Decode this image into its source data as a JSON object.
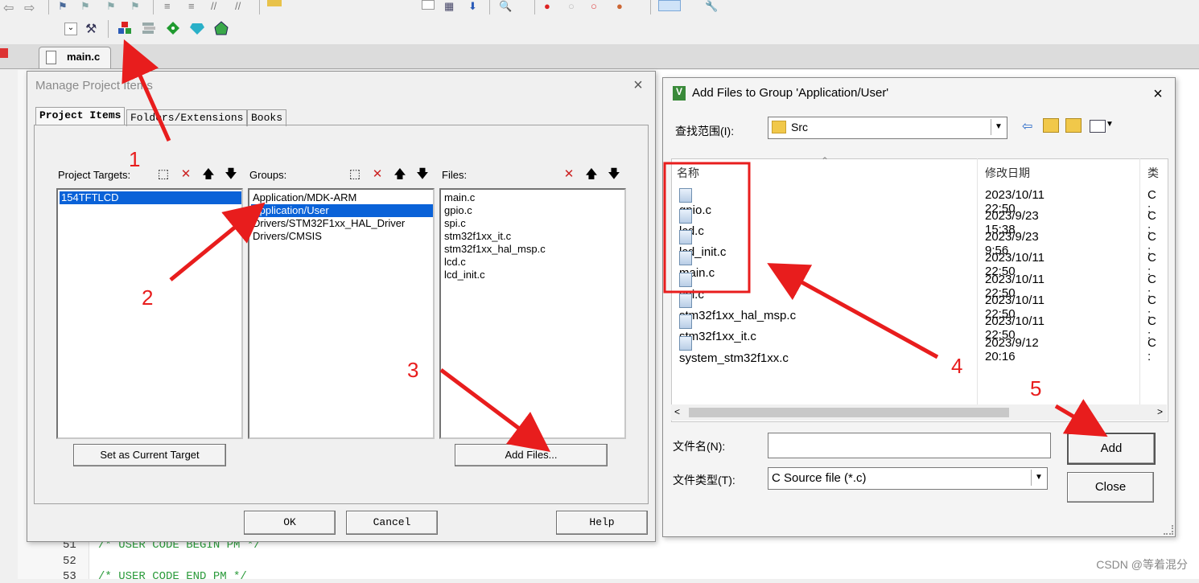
{
  "editor": {
    "tab_label": "main.c",
    "lines": [
      {
        "num": "51",
        "code": "/* USER CODE BEGIN PM */"
      },
      {
        "num": "52",
        "code": ""
      },
      {
        "num": "53",
        "code": "/* USER CODE END PM */"
      }
    ]
  },
  "manage_dialog": {
    "title": "Manage Project Items",
    "tabs": [
      "Project Items",
      "Folders/Extensions",
      "Books"
    ],
    "targets_label": "Project Targets:",
    "groups_label": "Groups:",
    "files_label": "Files:",
    "targets": [
      "154TFTLCD"
    ],
    "groups": [
      "Application/MDK-ARM",
      "Application/User",
      "Drivers/STM32F1xx_HAL_Driver",
      "Drivers/CMSIS"
    ],
    "selected_group": "Application/User",
    "files": [
      "main.c",
      "gpio.c",
      "spi.c",
      "stm32f1xx_it.c",
      "stm32f1xx_hal_msp.c",
      "lcd.c",
      "lcd_init.c"
    ],
    "set_target_label": "Set as Current Target",
    "add_files_label": "Add Files...",
    "ok_label": "OK",
    "cancel_label": "Cancel",
    "help_label": "Help"
  },
  "add_dialog": {
    "title": "Add Files to Group 'Application/User'",
    "lookin_label": "查找范围(I):",
    "lookin_value": "Src",
    "col_name": "名称",
    "col_date": "修改日期",
    "col_type": "类",
    "files": [
      {
        "name": "gpio.c",
        "date": "2023/10/11 22:50",
        "type": "C :"
      },
      {
        "name": "lcd.c",
        "date": "2023/9/23 15:38",
        "type": "C :"
      },
      {
        "name": "lcd_init.c",
        "date": "2023/9/23 9:56",
        "type": "C :"
      },
      {
        "name": "main.c",
        "date": "2023/10/11 22:50",
        "type": "C :"
      },
      {
        "name": "spi.c",
        "date": "2023/10/11 22:50",
        "type": "C :"
      },
      {
        "name": "stm32f1xx_hal_msp.c",
        "date": "2023/10/11 22:50",
        "type": "C :"
      },
      {
        "name": "stm32f1xx_it.c",
        "date": "2023/10/11 22:50",
        "type": "C :"
      },
      {
        "name": "system_stm32f1xx.c",
        "date": "2023/9/12 20:16",
        "type": "C :"
      }
    ],
    "filename_label": "文件名(N):",
    "filename_value": "",
    "filetype_label": "文件类型(T):",
    "filetype_value": "C Source file (*.c)",
    "add_label": "Add",
    "close_label": "Close"
  },
  "annotations": [
    "1",
    "2",
    "3",
    "4",
    "5"
  ],
  "watermark": "CSDN @等着混分",
  "colors": {
    "annotation_red": "#e81d1d",
    "selection_blue": "#0a62d8"
  }
}
